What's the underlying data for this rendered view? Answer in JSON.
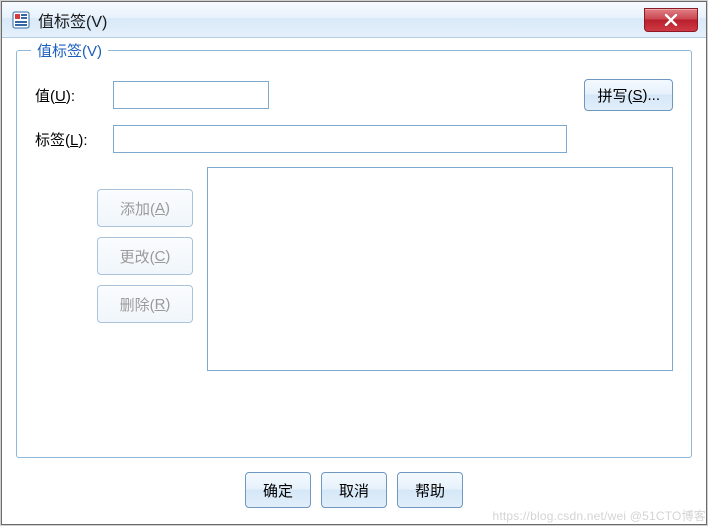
{
  "window": {
    "title": "值标签(V)"
  },
  "group": {
    "legend": "值标签(V)",
    "value_label_pre": "值(",
    "value_label_mn": "U",
    "value_label_post": "):",
    "value_input": "",
    "tag_label_pre": "标签(",
    "tag_label_mn": "L",
    "tag_label_post": "):",
    "tag_input": "",
    "spell_label_pre": "拼写(",
    "spell_label_mn": "S",
    "spell_label_post": ")...",
    "add_pre": "添加(",
    "add_mn": "A",
    "add_post": ")",
    "change_pre": "更改(",
    "change_mn": "C",
    "change_post": ")",
    "remove_pre": "删除(",
    "remove_mn": "R",
    "remove_post": ")"
  },
  "buttons": {
    "ok": "确定",
    "cancel": "取消",
    "help": "帮助"
  },
  "watermark": "https://blog.csdn.net/wei @51CTO博客"
}
